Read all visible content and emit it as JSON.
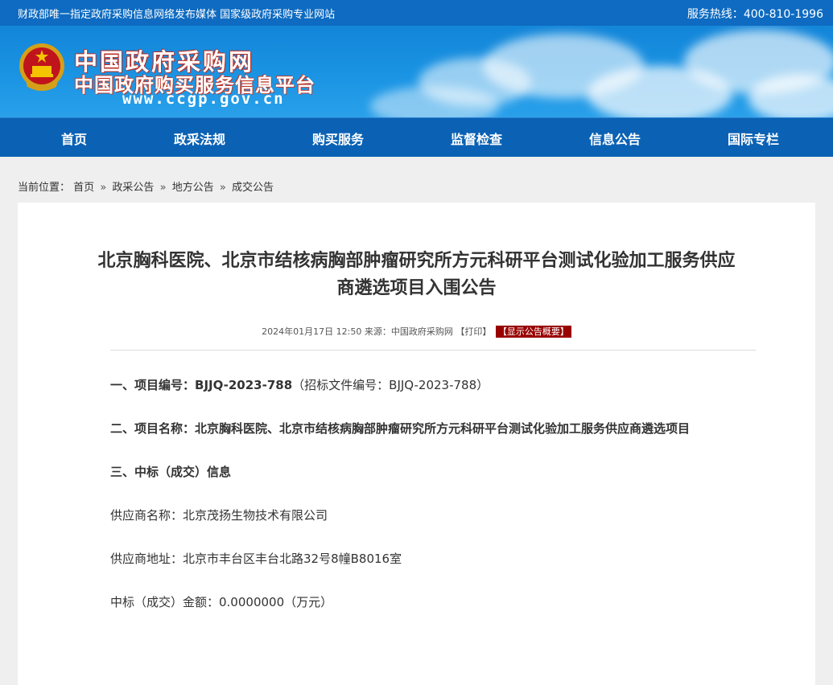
{
  "top_bar": {
    "left_text": "财政部唯一指定政府采购信息网络发布媒体 国家级政府采购专业网站",
    "hotline_label": "服务热线：",
    "hotline_number": "400-810-1996"
  },
  "logo": {
    "title": "中国政府采购网",
    "subtitle": "中国政府购买服务信息平台",
    "url": "www.ccgp.gov.cn"
  },
  "nav": {
    "items": [
      "首页",
      "政采法规",
      "购买服务",
      "监督检查",
      "信息公告",
      "国际专栏"
    ]
  },
  "breadcrumb": {
    "label": "当前位置：",
    "items": [
      "首页",
      "政采公告",
      "地方公告",
      "成交公告"
    ],
    "separator": "»"
  },
  "article": {
    "title_line1": "北京胸科医院、北京市结核病胸部肿瘤研究所方元科研平台测试化验加工服务供应",
    "title_line2": "商遴选项目入围公告",
    "meta_date": "2024年01月17日 12:50",
    "meta_source": "来源：中国政府采购网",
    "meta_print": "【打印】",
    "meta_summary": "【显示公告概要】",
    "s1_label": "一、项目编号：",
    "s1_value": "BJJQ-2023-788",
    "s1_extra": "（招标文件编号：BJJQ-2023-788）",
    "s2_label": "二、项目名称：",
    "s2_value": "北京胸科医院、北京市结核病胸部肿瘤研究所方元科研平台测试化验加工服务供应商遴选项目",
    "s3_label": "三、中标（成交）信息",
    "supplier_name": "供应商名称：北京茂扬生物技术有限公司",
    "supplier_address": "供应商地址：北京市丰台区丰台北路32号8幢B8016室",
    "amount": "中标（成交）金额：0.0000000（万元）"
  },
  "colors": {
    "top_bar": "#0e6bc1",
    "nav": "#0b62b4",
    "badge": "#990000"
  }
}
